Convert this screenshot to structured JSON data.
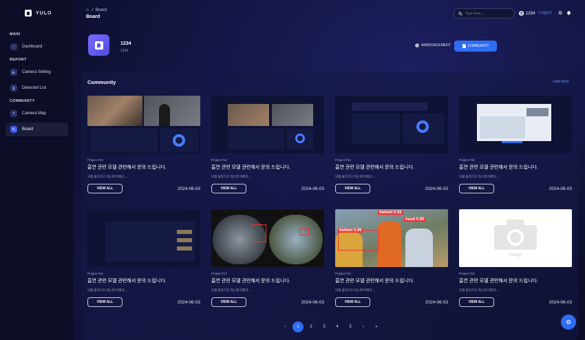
{
  "app": {
    "logo_text": "YULO"
  },
  "sidebar": {
    "sections": [
      {
        "label": "MAIN",
        "items": [
          {
            "label": "Dashboard",
            "icon": "home-icon"
          }
        ]
      },
      {
        "label": "REPORT",
        "items": [
          {
            "label": "Camera Setting",
            "icon": "video-icon"
          },
          {
            "label": "Detected List",
            "icon": "chart-icon"
          }
        ]
      },
      {
        "label": "COMMUNITY",
        "items": [
          {
            "label": "Camera Map",
            "icon": "map-pin-icon"
          },
          {
            "label": "Board",
            "icon": "wrench-icon",
            "active": true
          }
        ]
      }
    ]
  },
  "header": {
    "breadcrumb_current": "Board",
    "title": "Board",
    "search_placeholder": "Type here...",
    "user": "1234",
    "logout": "Logout"
  },
  "profile": {
    "name": "1234",
    "sub": "1234",
    "announcement": "ANNOUNCEMENT",
    "community": "COMMUNITY"
  },
  "community": {
    "title": "Community",
    "add_write": "+ Add Write",
    "view_all_label": "VIEW ALL",
    "cards": [
      {
        "project": "Project #12",
        "title": "흡연 관련 모델 관련해서 문의 드립니다.",
        "desc": "모델 돌리기고 하는데 어쩌고.....",
        "date": "2024-06-03",
        "thumb": "cctv-dashboard"
      },
      {
        "project": "Project #13",
        "title": "흡연 관련 모델 관련해서 문의 드립니다.",
        "desc": "모델 돌리기고 하는데 어쩌고.....",
        "date": "2024-06-03",
        "thumb": "dashboard-light"
      },
      {
        "project": "Project #14",
        "title": "흡연 관련 모델 관련해서 문의 드립니다.",
        "desc": "모델 돌리기고 하는데 어쩌고.....",
        "date": "2024-06-03",
        "thumb": "dashboard-dark"
      },
      {
        "project": "Project #15",
        "title": "흡연 관련 모델 관련해서 문의 드립니다.",
        "desc": "모델 돌리기고 하는데 어쩌고.....",
        "date": "2024-06-03",
        "thumb": "dashboard-map"
      },
      {
        "project": "Project #16",
        "title": "흡연 관련 모델 관련해서 문의 드립니다.",
        "desc": "모델 돌리기고 하는데 어쩌고.....",
        "date": "2024-06-03",
        "thumb": "list-dark"
      },
      {
        "project": "Project #17",
        "title": "흡연 관련 모델 관련해서 문의 드립니다.",
        "desc": "모델 돌리기고 하는데 어쩌고.....",
        "date": "2024-06-03",
        "thumb": "fisheye-camera"
      },
      {
        "project": "Project #18",
        "title": "흡연 관련 모델 관련해서 문의 드립니다.",
        "desc": "모델 돌리기고 하는데 어쩌고.....",
        "date": "2024-06-03",
        "thumb": "helmet-detection",
        "labels": [
          "helmet 0.92",
          "head 0.90",
          "helmet 0.90"
        ]
      },
      {
        "project": "Project #19",
        "title": "흡연 관련 모델 관련해서 문의 드립니다.",
        "desc": "모델 돌리기고 하는데 어쩌고.....",
        "date": "2024-06-03",
        "thumb": "placeholder",
        "placeholder_text": "Image"
      }
    ]
  },
  "pagination": {
    "prev": "‹",
    "pages": [
      "1",
      "2",
      "3",
      "4",
      "5"
    ],
    "current": "1",
    "next": "›",
    "last": "»"
  },
  "colors": {
    "accent": "#2f6df5",
    "background": "#0a0d24",
    "link": "#5f8cff"
  }
}
